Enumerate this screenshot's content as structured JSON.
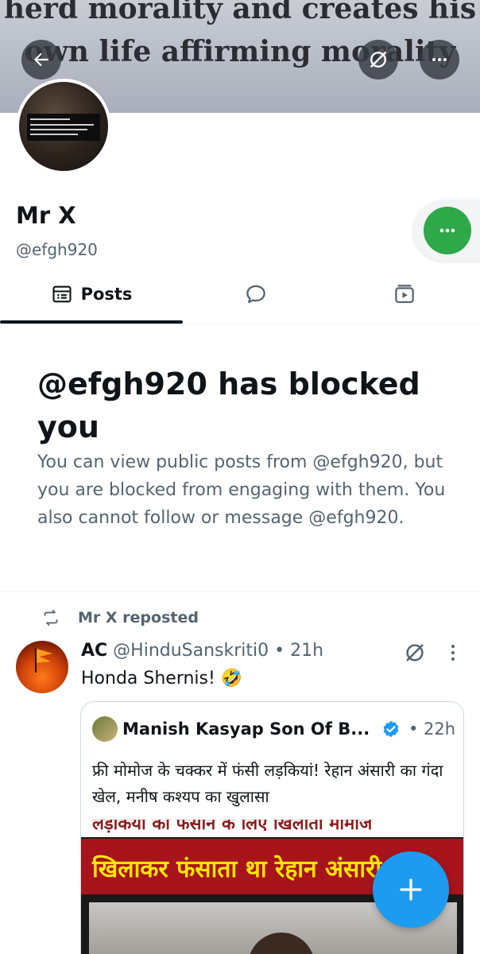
{
  "banner": {
    "line1": "herd morality and creates his",
    "line2": "own life affirming morality"
  },
  "profile": {
    "display_name": "Mr X",
    "handle": "@efgh920"
  },
  "tabs": [
    {
      "label": "Posts",
      "icon": "posts-icon",
      "active": true
    },
    {
      "label": "",
      "icon": "replies-icon",
      "active": false
    },
    {
      "label": "",
      "icon": "media-icon",
      "active": false
    }
  ],
  "blocked": {
    "title": "@efgh920 has blocked you",
    "body": "You can view public posts from @efgh920, but you are blocked from engaging with them. You also cannot follow or message @efgh920."
  },
  "post": {
    "repost_label": "Mr X reposted",
    "author": "AC",
    "meta": " @HinduSanskriti0 • 21h",
    "text": "Honda Shernis! 🤣",
    "quote": {
      "author": "Manish Kasyap Son Of B...",
      "time": "• 22h",
      "text": "फ्री मोमोज के चक्कर में फंसी लड़कियां! रेहान अंसारी का गंदा खेल, मनीष कश्यप का खुलासा",
      "media_top": "लड़कियों को फंसाने के लिए खिलाता मोमोज",
      "media_headline": "खिलाकर फंसाता था रेहान अंसारी"
    }
  },
  "colors": {
    "accent_blue": "#1d9bf0",
    "green_action": "#2fa84a",
    "secondary_text": "#536471",
    "primary_text": "#0f1419"
  }
}
